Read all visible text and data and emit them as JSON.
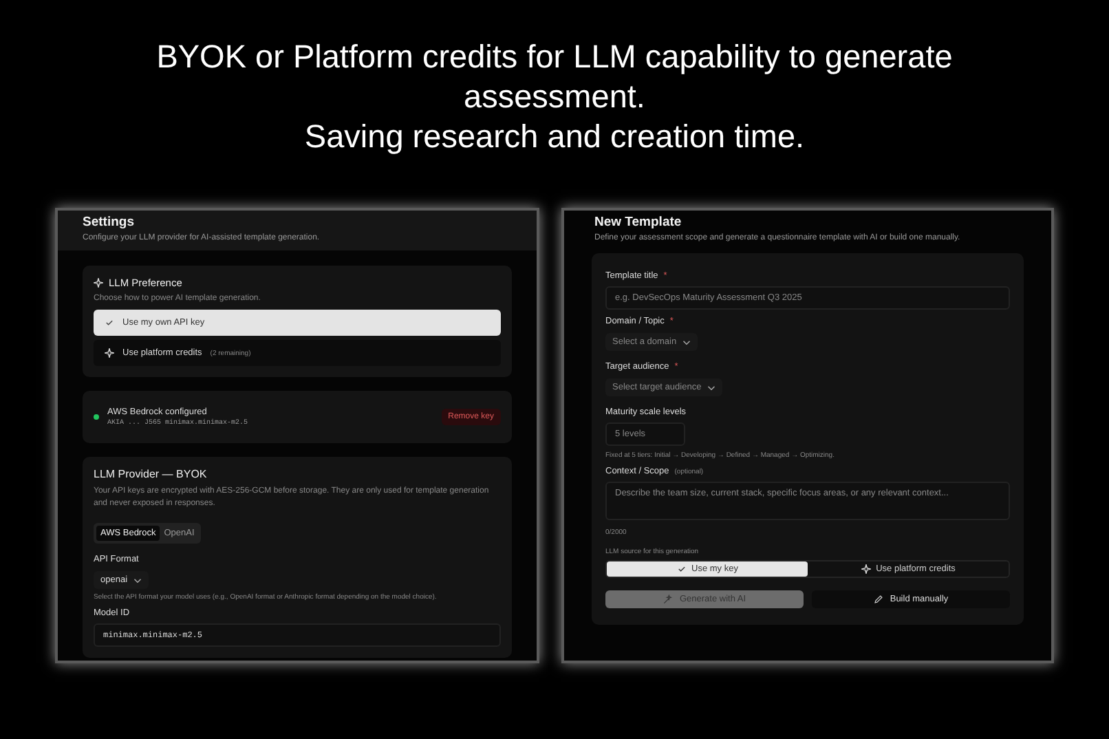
{
  "headline": {
    "lines": [
      "BYOK or Platform credits for LLM capability to generate assessment.",
      "Saving research and creation time."
    ]
  },
  "settings": {
    "title": "Settings",
    "subtitle": "Configure your LLM provider for AI-assisted template generation.",
    "preference": {
      "title": "LLM Preference",
      "description": "Choose how to power AI template generation.",
      "options": [
        {
          "label": "Use my own API key",
          "selected": true
        },
        {
          "label": "Use platform credits",
          "note": "(2 remaining)",
          "selected": false
        }
      ]
    },
    "status": {
      "label": "AWS Bedrock configured",
      "key": "AKIA ... J565 minimax.minimax-m2.5",
      "button": "Remove key"
    },
    "provider": {
      "title": "LLM Provider — BYOK",
      "description": "Your API keys are encrypted with AES-256-GCM before storage. They are only used for template generation and never exposed in responses.",
      "tabs": [
        {
          "label": "AWS Bedrock",
          "selected": true
        },
        {
          "label": "OpenAI",
          "selected": false
        }
      ],
      "api_format": {
        "label": "API Format",
        "value": "openai",
        "help": "Select the API format your model uses (e.g., OpenAI format or Anthropic format depending on the model choice)."
      },
      "model_id": {
        "label": "Model ID",
        "value": "minimax.minimax-m2.5"
      }
    }
  },
  "template": {
    "title": "New Template",
    "subtitle": "Define your assessment scope and generate a questionnaire template with AI or build one manually.",
    "fields": [
      {
        "kind": "input",
        "label": "Template title",
        "required_mark": "*",
        "placeholder": "e.g. DevSecOps Maturity Assessment Q3 2025"
      },
      {
        "kind": "select",
        "label": "Domain / Topic",
        "required_mark": "*",
        "placeholder": "Select a domain"
      },
      {
        "kind": "select",
        "label": "Target audience",
        "required_mark": "*",
        "placeholder": "Select target audience"
      },
      {
        "kind": "fixed",
        "label": "Maturity scale levels",
        "value": "5 levels",
        "help": "Fixed at 5 tiers: Initial → Developing → Defined → Managed → Optimizing."
      },
      {
        "kind": "textarea",
        "label": "Context / Scope",
        "note": "(optional)",
        "placeholder": "Describe the team size, current stack, specific focus areas, or any relevant context...",
        "counter": "0/2000"
      }
    ],
    "source": {
      "label": "LLM source for this generation",
      "options": [
        {
          "label": "Use my key",
          "selected": true
        },
        {
          "label": "Use platform credits",
          "selected": false
        }
      ]
    },
    "buttons": [
      {
        "label": "Generate with AI",
        "kind": "ai"
      },
      {
        "label": "Build manually",
        "kind": "manual"
      }
    ]
  }
}
